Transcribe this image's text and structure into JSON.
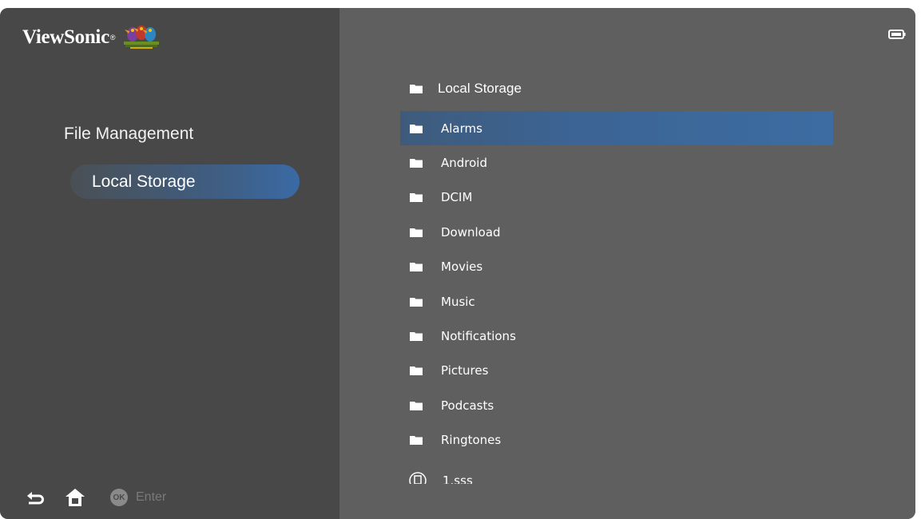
{
  "brand": {
    "name": "ViewSonic",
    "reg": "®",
    "logo_icon": "birds-logo"
  },
  "sidebar": {
    "title": "File Management",
    "items": [
      {
        "label": "Local Storage",
        "selected": true
      }
    ]
  },
  "footer": {
    "back_icon": "back-arrow-icon",
    "home_icon": "home-icon",
    "ok_badge": "OK",
    "enter_label": "Enter"
  },
  "status": {
    "battery_icon": "battery-icon"
  },
  "main": {
    "path_label": "Local Storage",
    "folders": [
      {
        "label": "Alarms",
        "selected": true
      },
      {
        "label": "Android"
      },
      {
        "label": "DCIM"
      },
      {
        "label": "Download"
      },
      {
        "label": "Movies"
      },
      {
        "label": "Music"
      },
      {
        "label": "Notifications"
      },
      {
        "label": "Pictures"
      },
      {
        "label": "Podcasts"
      },
      {
        "label": "Ringtones"
      }
    ],
    "partial_item": {
      "label": "1.sss",
      "icon": "sd-card-icon"
    }
  },
  "colors": {
    "sidebar_bg": "#484848",
    "main_bg": "#5f5f5f",
    "accent": "#3d6ca2"
  }
}
